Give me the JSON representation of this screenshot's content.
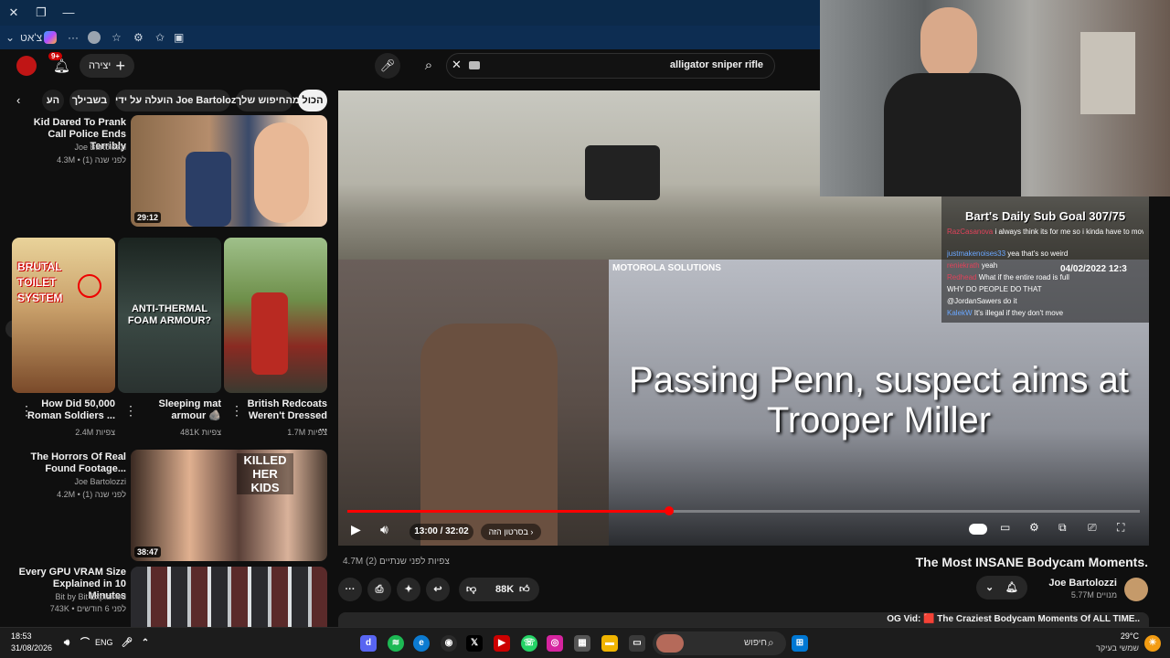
{
  "search": {
    "query": "alligator sniper rifle"
  },
  "header": {
    "create_label": "יצירה",
    "notif_count": "9+"
  },
  "filters": [
    "הכול",
    "מהחיפוש שלך",
    "הועלה על ידי Joe Bartolozzi",
    "בשבילך",
    "הע"
  ],
  "recommended": [
    {
      "title": "Kid Dared To Prank Call Police Ends Terribly",
      "channel": "Joe Bartolozzi",
      "meta": "4.3M • לפני שנה (1)",
      "duration": "29:12"
    },
    {
      "title": "The Horrors Of Real Found Footage...",
      "channel": "Joe Bartolozzi",
      "meta": "4.2M • לפני שנה (1)",
      "duration": "38:47",
      "thumb_text": "KILLED HER KIDS"
    },
    {
      "title": "Every GPU VRAM Size Explained in 10 Minutes",
      "channel": "Bit by Bit Explained",
      "meta": "743K • לפני 6 חודשים"
    }
  ],
  "shorts": [
    {
      "title": "How Did 50,000 Roman Soldiers ...",
      "views": "2.4M צפיות",
      "thumb_text": "BRUTAL TOILET SYSTEM"
    },
    {
      "title": "Sleeping mat armour 🪨",
      "views": "481K צפיות",
      "thumb_text": "ANTI-THERMAL FOAM ARMOUR?"
    },
    {
      "title": "British Redcoats Weren't Dressed ...",
      "views": "1.7M צפיות"
    }
  ],
  "player": {
    "overlay_text": "Passing Penn, suspect aims at Trooper Miller",
    "camera_brand": "MOTOROLA SOLUTIONS",
    "dashcam_date": "04/02/2022 12:3",
    "time": "13:00 / 32:02",
    "version_label": "בסרטון הזה",
    "progress": 0.406
  },
  "video": {
    "title": "The Most INSANE Bodycam Moments.",
    "views_meta": "4.7M צפיות  לפני שנתיים (2)",
    "channel": "Joe Bartolozzi",
    "subscribers": "5.77M מנויים",
    "likes": "88K",
    "description_preview": "OG Vid: 🟥 The Craziest Bodycam Moments Of ALL TIME.."
  },
  "stream": {
    "sub_goal": "Bart's Daily Sub Goal 307/75",
    "chat": [
      {
        "user": "RazCasanova",
        "msg": "i always think its for me so i kinda have to move",
        "color": "#e0425a"
      },
      {
        "user": "",
        "msg": "yea that's so weird",
        "color": "#ffffff"
      },
      {
        "user": "justmakenoises33",
        "msg": "yea that's so weird",
        "color": "#6aa7ff"
      },
      {
        "user": "reniekrath",
        "msg": "yeah",
        "color": "#e0425a"
      },
      {
        "user": "Redhead",
        "msg": "What if the entire road is full",
        "color": "#e0425a"
      },
      {
        "user": "",
        "msg": "WHY DO PEOPLE DO THAT",
        "color": "#e0425a"
      },
      {
        "user": "",
        "msg": "@JordanSawers do it",
        "color": "#e0425a"
      },
      {
        "user": "KalekW",
        "msg": "It's illegal if they don't move",
        "color": "#6aa7ff"
      }
    ]
  },
  "browser": {
    "profile_label": "צ'אט"
  },
  "taskbar": {
    "time": "18:53",
    "date": "31/08/2026",
    "lang": "ENG",
    "search_placeholder": "חיפוש",
    "weather_temp": "29°C",
    "weather_desc": "שמשי בעיקר"
  }
}
